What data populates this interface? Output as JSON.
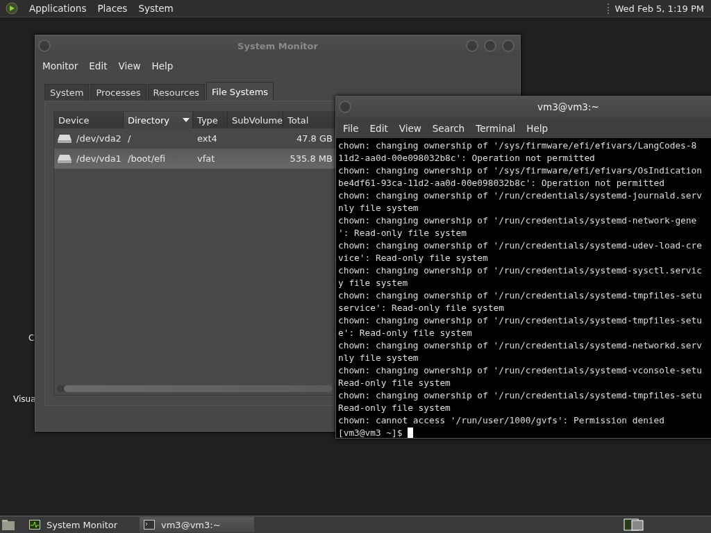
{
  "top_panel": {
    "menus": [
      "Applications",
      "Places",
      "System"
    ],
    "clock": "Wed Feb 5, 1:19 PM"
  },
  "desktop_icons": [
    {
      "label": "C"
    },
    {
      "label": "Visua"
    }
  ],
  "system_monitor": {
    "title": "System Monitor",
    "menus": [
      "Monitor",
      "Edit",
      "View",
      "Help"
    ],
    "tabs": [
      {
        "label": "System",
        "selected": false
      },
      {
        "label": "Processes",
        "selected": false
      },
      {
        "label": "Resources",
        "selected": false
      },
      {
        "label": "File Systems",
        "selected": true
      }
    ],
    "table": {
      "columns": [
        {
          "label": "Device",
          "sorted": false
        },
        {
          "label": "Directory",
          "sorted": true
        },
        {
          "label": "Type",
          "sorted": false
        },
        {
          "label": "SubVolume",
          "sorted": false
        },
        {
          "label": "Total",
          "sorted": false
        }
      ],
      "rows": [
        {
          "device": "/dev/vda2",
          "directory": "/",
          "type": "ext4",
          "total": "47.8 GB",
          "selected": false
        },
        {
          "device": "/dev/vda1",
          "directory": "/boot/efi",
          "type": "vfat",
          "total": "535.8 MB",
          "selected": true
        }
      ]
    }
  },
  "terminal": {
    "title": "vm3@vm3:~",
    "menus": [
      "File",
      "Edit",
      "View",
      "Search",
      "Terminal",
      "Help"
    ],
    "lines": [
      "chown: changing ownership of '/sys/firmware/efi/efivars/LangCodes-8",
      "11d2-aa0d-00e098032b8c': Operation not permitted",
      "chown: changing ownership of '/sys/firmware/efi/efivars/OsIndication",
      "be4df61-93ca-11d2-aa0d-00e098032b8c': Operation not permitted",
      "chown: changing ownership of '/run/credentials/systemd-journald.serv",
      "nly file system",
      "chown: changing ownership of '/run/credentials/systemd-network-gene",
      "': Read-only file system",
      "chown: changing ownership of '/run/credentials/systemd-udev-load-cre",
      "vice': Read-only file system",
      "chown: changing ownership of '/run/credentials/systemd-sysctl.servic",
      "y file system",
      "chown: changing ownership of '/run/credentials/systemd-tmpfiles-setu",
      "service': Read-only file system",
      "chown: changing ownership of '/run/credentials/systemd-tmpfiles-setu",
      "e': Read-only file system",
      "chown: changing ownership of '/run/credentials/systemd-networkd.serv",
      "nly file system",
      "chown: changing ownership of '/run/credentials/systemd-vconsole-setu",
      "Read-only file system",
      "chown: changing ownership of '/run/credentials/systemd-tmpfiles-setu",
      "Read-only file system",
      "chown: cannot access '/run/user/1000/gvfs': Permission denied"
    ],
    "prompt": "[vm3@vm3 ~]$"
  },
  "taskbar": [
    {
      "label": "System Monitor",
      "kind": "monitor",
      "selected": false
    },
    {
      "label": "vm3@vm3:~",
      "kind": "terminal",
      "selected": true
    }
  ]
}
